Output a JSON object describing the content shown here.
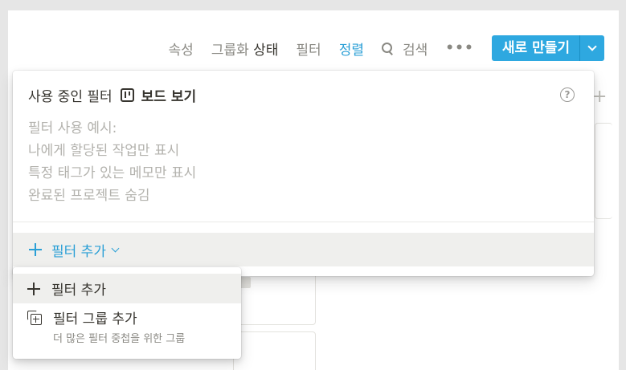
{
  "toolbar": {
    "properties": "속성",
    "group_by_prefix": "그룹화",
    "group_by_value": "상태",
    "filter": "필터",
    "sort": "정렬",
    "search": "검색",
    "more": "•••",
    "new_button": "새로 만들기"
  },
  "filter_popup": {
    "header_prefix": "사용 중인 필터",
    "view_name": "보드 보기",
    "help": "?",
    "hint_lines": [
      "필터 사용 예시:",
      "나에게 할당된 작업만 표시",
      "특정 태그가 있는 메모만 표시",
      "완료된 프로젝트 숨김"
    ],
    "add_filter": "필터 추가"
  },
  "menu": {
    "items": [
      {
        "label": "필터 추가",
        "icon": "plus-icon"
      },
      {
        "label": "필터 그룹 추가",
        "sublabel": "더 많은 필터 중첩을 위한 그룹",
        "icon": "copy-plus-icon"
      }
    ]
  },
  "colors": {
    "accent": "#2ea8e0",
    "link": "#2a9fd6",
    "text": "#37352f",
    "muted": "#8a8983",
    "hover": "#efefed"
  }
}
